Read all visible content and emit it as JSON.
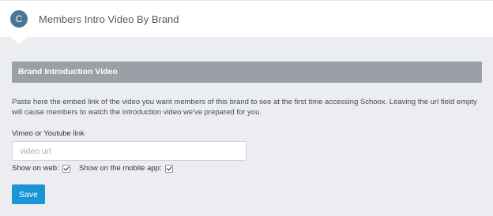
{
  "header": {
    "avatar_letter": "C",
    "title": "Members Intro Video By Brand"
  },
  "section": {
    "title": "Brand Introduction Video",
    "description": "Paste here the embed link of the video you want members of this brand to see at the first time accessing Schoox. Leaving the url field empty will cause members to watch the introduction video we've prepared for you."
  },
  "form": {
    "link_label": "Vimeo or Youtube link",
    "link_value": "",
    "link_placeholder": "video url",
    "show_web_label": "Show on web:",
    "show_web_checked": true,
    "show_mobile_label": "Show on the mobile app:",
    "show_mobile_checked": true,
    "save_label": "Save"
  },
  "colors": {
    "page_background": "#ebedf1",
    "avatar": "#4b7690",
    "section_bar": "#9aa0a5",
    "save_button": "#1a96d6"
  }
}
